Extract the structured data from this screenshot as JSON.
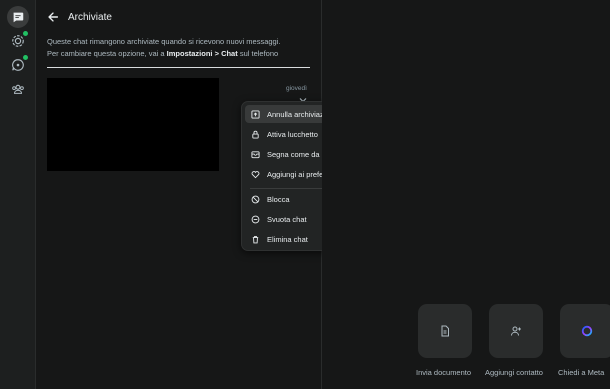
{
  "header": {
    "title": "Archiviate"
  },
  "info": {
    "line1": "Queste chat rimangono archiviate quando si ricevono nuovi messaggi.",
    "line2_prefix": "Per cambiare questa opzione, vai a ",
    "line2_bold1": "Impostazioni",
    "line2_sep": " > ",
    "line2_bold2": "Chat",
    "line2_suffix": " sul telefono"
  },
  "chat": {
    "time": "giovedì"
  },
  "context_menu": {
    "items": [
      {
        "label": "Annulla archiviazione chat",
        "icon": "unarchive-icon"
      },
      {
        "label": "Attiva lucchetto",
        "icon": "lock-icon"
      },
      {
        "label": "Segna come da leggere",
        "icon": "mark-unread-icon"
      },
      {
        "label": "Aggiungi ai preferiti",
        "icon": "heart-icon"
      },
      {
        "label": "Blocca",
        "icon": "block-icon"
      },
      {
        "label": "Svuota chat",
        "icon": "clear-chat-icon"
      },
      {
        "label": "Elimina chat",
        "icon": "trash-icon"
      }
    ]
  },
  "actions": [
    {
      "label": "Invia documento",
      "icon": "document-icon"
    },
    {
      "label": "Aggiungi contatto",
      "icon": "add-contact-icon"
    },
    {
      "label": "Chiedi a Meta",
      "icon": "meta-ai-icon"
    }
  ],
  "colors": {
    "accent": "#21c063",
    "background": "#161717",
    "menu_highlight": "#383a3a"
  }
}
